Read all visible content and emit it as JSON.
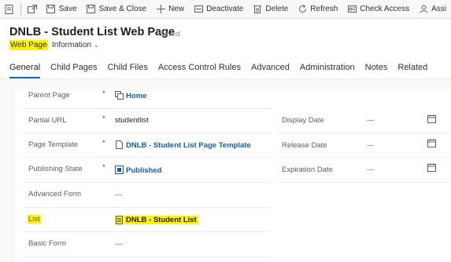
{
  "command_bar": {
    "save": "Save",
    "save_close": "Save & Close",
    "new": "New",
    "deactivate": "Deactivate",
    "delete": "Delete",
    "refresh": "Refresh",
    "check_access": "Check Access",
    "assign": "Assi"
  },
  "header": {
    "title": "DNLB - Student List Web Page",
    "saved_status": "- Saved",
    "entity": "Web Page",
    "separator": "·",
    "form_name": "Information"
  },
  "tabs": [
    "General",
    "Child Pages",
    "Child Files",
    "Access Control Rules",
    "Advanced",
    "Administration",
    "Notes",
    "Related"
  ],
  "active_tab": "General",
  "fields": {
    "parent_page": {
      "label": "Parent Page",
      "value": "Home",
      "required": "*"
    },
    "partial_url": {
      "label": "Partial URL",
      "value": "studentlist",
      "required": "*"
    },
    "page_template": {
      "label": "Page Template",
      "value": "DNLB - Student List Page Template",
      "required": "*"
    },
    "publishing_state": {
      "label": "Publishing State",
      "value": "Published",
      "required": "*"
    },
    "advanced_form": {
      "label": "Advanced Form",
      "value": "---"
    },
    "list": {
      "label": "List",
      "value": "DNLB - Student List"
    },
    "basic_form": {
      "label": "Basic Form",
      "value": "---"
    },
    "display_date": {
      "label": "Display Date",
      "value": "---"
    },
    "release_date": {
      "label": "Release Date",
      "value": "---"
    },
    "expiration_date": {
      "label": "Expiration Date",
      "value": "---"
    }
  },
  "colors": {
    "highlight": "#fff200",
    "accent": "#0f6cbd",
    "link": "#115ea3",
    "required": "#a4262c"
  }
}
